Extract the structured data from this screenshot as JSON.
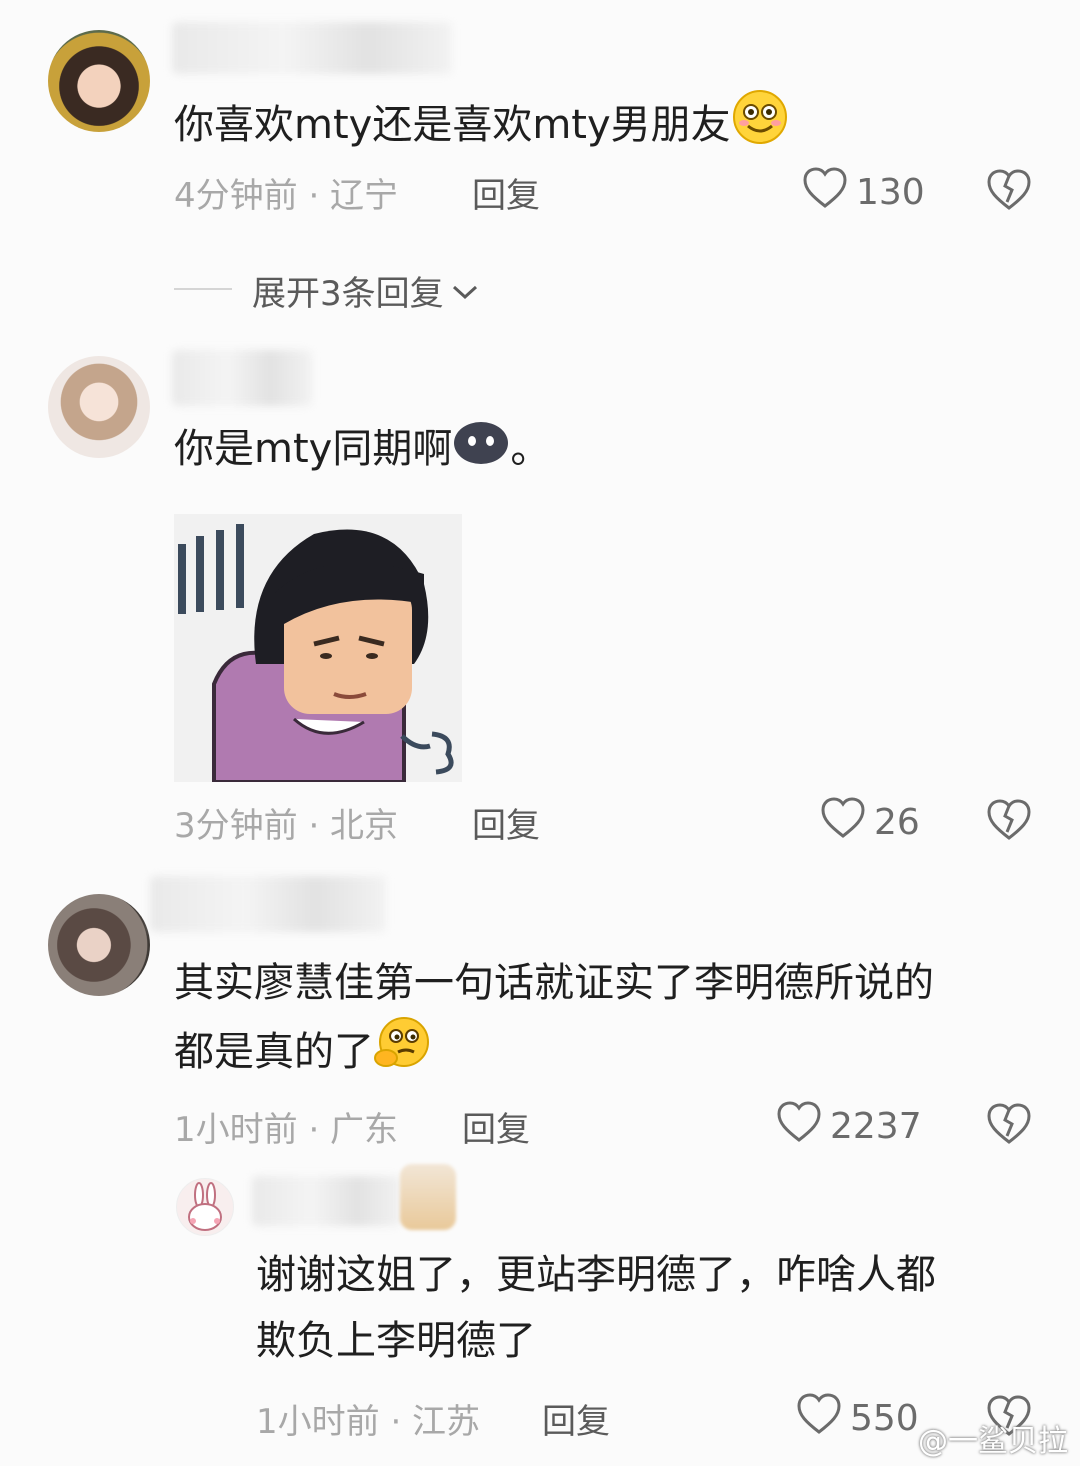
{
  "comments": [
    {
      "text": "你喜欢mty还是喜欢mty男朋友",
      "emoji_icon": "smiling-face-emoji-icon",
      "meta": "4分钟前 · 辽宁",
      "reply_label": "回复",
      "likes": "130",
      "expand_label": "展开3条回复"
    },
    {
      "text": "你是mty同期啊",
      "emoji_icon": "dark-blob-emoji-icon",
      "text_suffix": "。",
      "sticker_icon": "sighing-cartoon-girl-sticker",
      "meta": "3分钟前 · 北京",
      "reply_label": "回复",
      "likes": "26"
    },
    {
      "text_line1": "其实廖慧佳第一句话就证实了李明德所说的",
      "text_line2": "都是真的了",
      "emoji_icon": "thinking-face-emoji-icon",
      "meta": "1小时前 · 广东",
      "reply_label": "回复",
      "likes": "2237"
    },
    {
      "text_line1": "谢谢这姐了，更站李明德了，咋啥人都",
      "text_line2": "欺负上李明德了",
      "meta": "1小时前 · 江苏",
      "reply_label": "回复",
      "likes": "550"
    }
  ],
  "watermark": "@一鲨贝拉"
}
